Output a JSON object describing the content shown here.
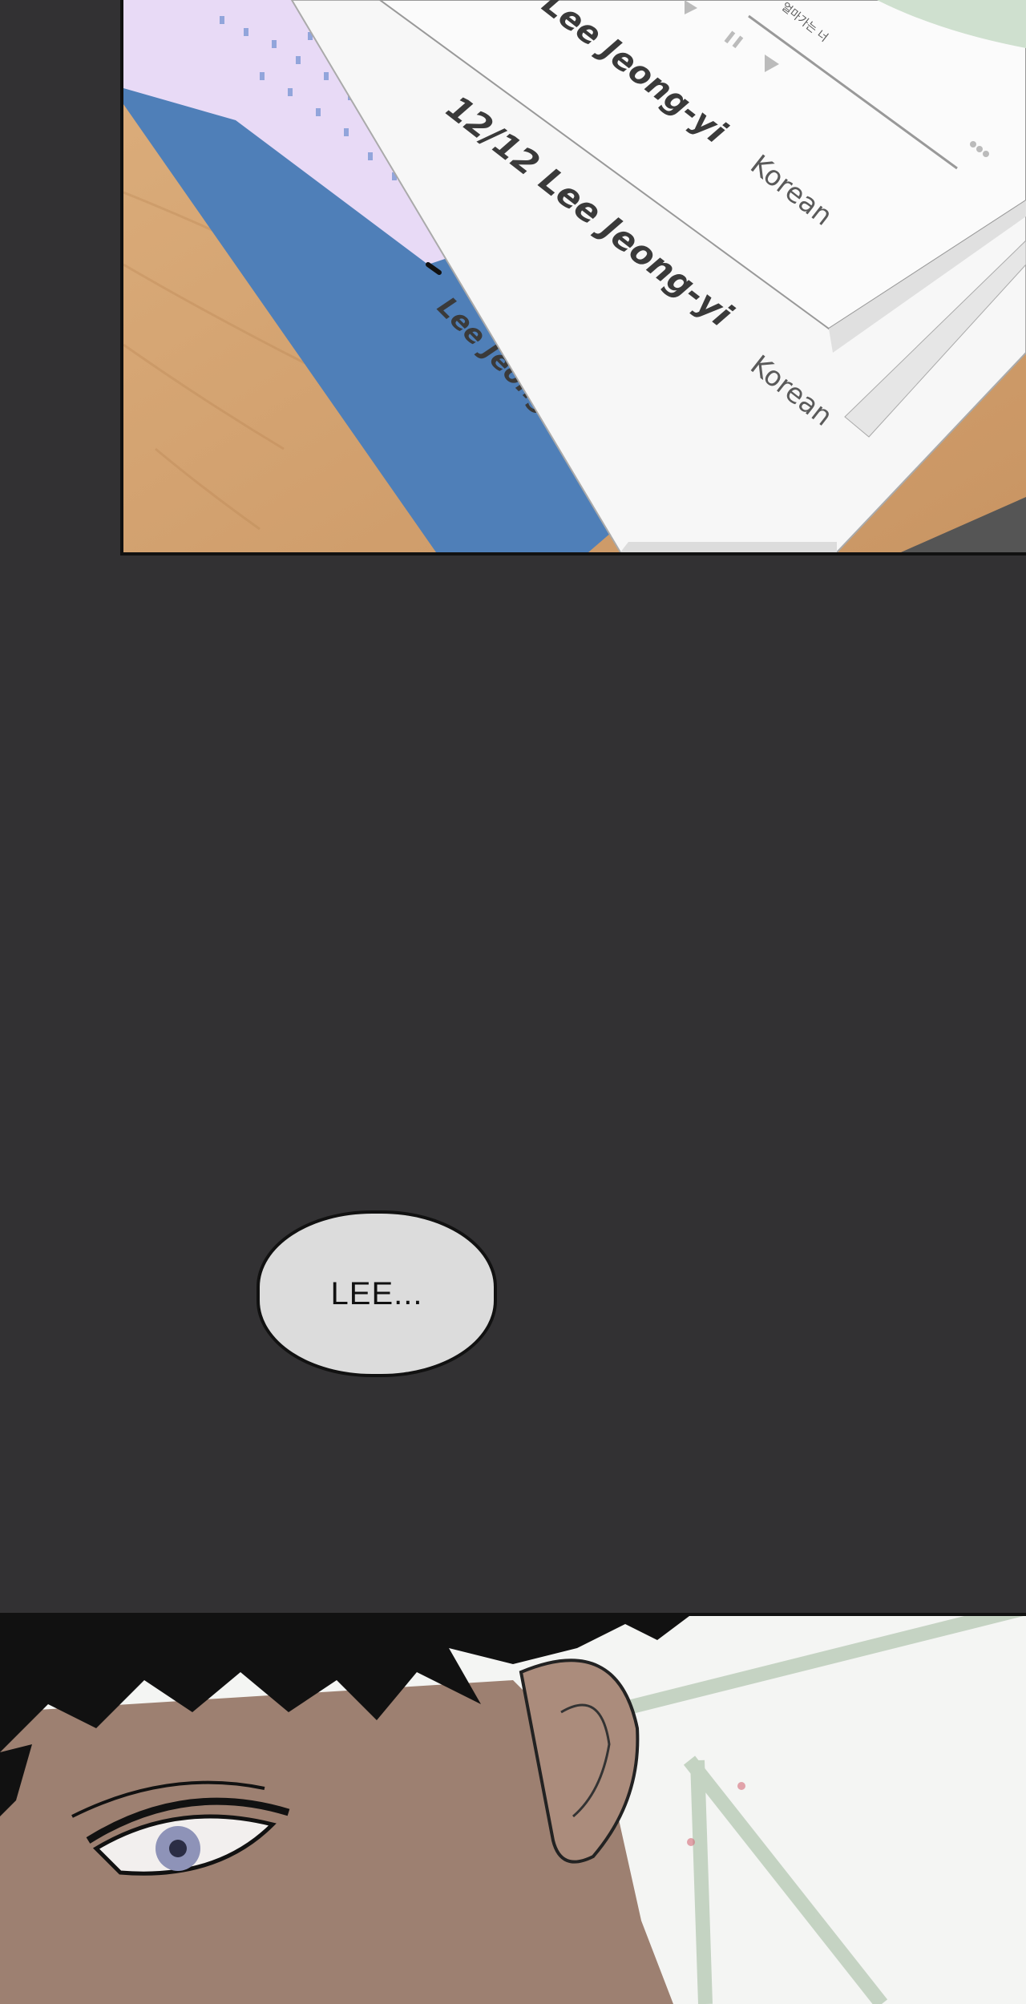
{
  "panel_top": {
    "card_front_name": "Lee Jeong-yi",
    "card_front_lang": "Korean",
    "card_front_small": "얼마가는 너",
    "card_middle_title": "12/12 Lee Jeong-yi",
    "card_middle_lang": "Korean",
    "notebook_name": "Lee Jeong-yi"
  },
  "speech_bubble": {
    "text": "LEE..."
  },
  "colors": {
    "background": "#323133",
    "desk": "#d9a774",
    "notebook_blue": "#4f7fb8",
    "notebook_lilac": "#e6d8f6",
    "bubble": "#dcdcdc"
  }
}
